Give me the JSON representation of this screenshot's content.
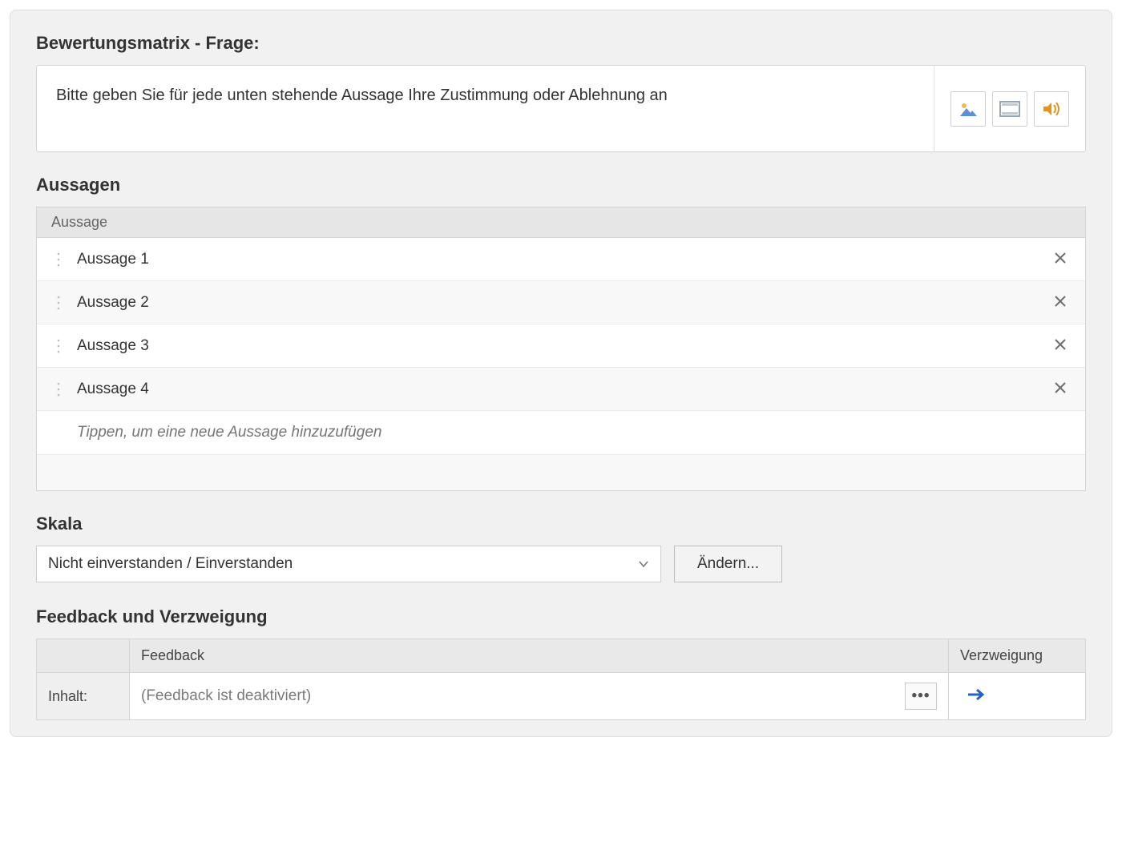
{
  "question": {
    "title": "Bewertungsmatrix - Frage:",
    "text": "Bitte geben Sie für jede unten stehende Aussage Ihre Zustimmung oder Ablehnung an"
  },
  "media_icons": {
    "image": "image-icon",
    "video": "video-icon",
    "audio": "audio-icon"
  },
  "statements": {
    "title": "Aussagen",
    "column_header": "Aussage",
    "items": [
      {
        "label": "Aussage 1"
      },
      {
        "label": "Aussage 2"
      },
      {
        "label": "Aussage 3"
      },
      {
        "label": "Aussage 4"
      }
    ],
    "new_placeholder": "Tippen, um eine neue Aussage hinzuzufügen"
  },
  "scale": {
    "title": "Skala",
    "selected": "Nicht einverstanden / Einverstanden",
    "change_button": "Ändern..."
  },
  "feedback": {
    "title": "Feedback und Verzweigung",
    "col_feedback": "Feedback",
    "col_branching": "Verzweigung",
    "row_label": "Inhalt:",
    "disabled_text": "(Feedback ist deaktiviert)"
  }
}
